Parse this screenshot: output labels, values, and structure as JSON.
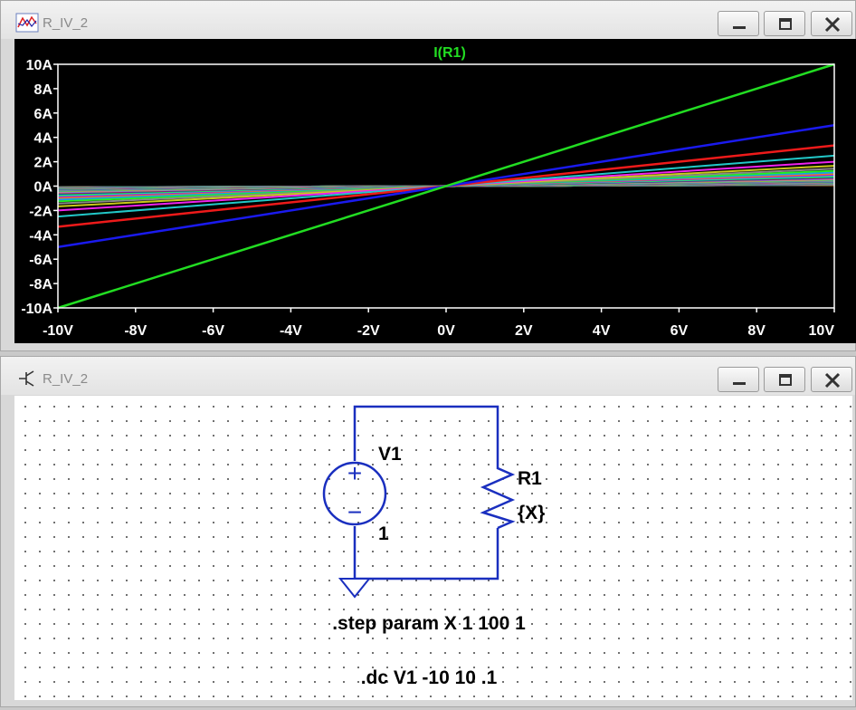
{
  "plot_window": {
    "title": "R_IV_2",
    "trace_label": "I(R1)",
    "buttons": {
      "minimize": "minimize",
      "maximize": "maximize",
      "close": "close"
    }
  },
  "schematic_window": {
    "title": "R_IV_2",
    "source_name": "V1",
    "source_value": "1",
    "source_plus": "+",
    "source_minus": "−",
    "resistor_name": "R1",
    "resistor_value": "{X}",
    "directive_step": ".step param X 1 100 1",
    "directive_dc": ".dc V1 -10 10 .1"
  },
  "colors": {
    "plot_bg": "#000000",
    "axis": "#ffffff",
    "trace_primary": "#22dd22",
    "wire": "#1a2fbf",
    "ground": "#1a2fbf"
  },
  "chart_data": {
    "type": "line",
    "title": "I(R1)",
    "xlabel": "",
    "ylabel": "",
    "xlim": [
      -10,
      10
    ],
    "ylim": [
      -10,
      10
    ],
    "x_ticks": [
      "-10V",
      "-8V",
      "-6V",
      "-4V",
      "-2V",
      "0V",
      "2V",
      "4V",
      "6V",
      "8V",
      "10V"
    ],
    "y_ticks": [
      "10A",
      "8A",
      "6A",
      "4A",
      "2A",
      "0A",
      "-2A",
      "-4A",
      "-6A",
      "-8A",
      "-10A"
    ],
    "x_tick_values": [
      -10,
      -8,
      -6,
      -4,
      -2,
      0,
      2,
      4,
      6,
      8,
      10
    ],
    "y_tick_values": [
      10,
      8,
      6,
      4,
      2,
      0,
      -2,
      -4,
      -6,
      -8,
      -10
    ],
    "grid": false,
    "series_rule": "I = V / X for X = 1 to 100 step 1",
    "x": [
      -10,
      10
    ],
    "resistances": [
      1,
      2,
      3,
      4,
      5,
      6,
      7,
      8,
      9,
      10,
      11,
      12,
      13,
      14,
      15,
      16,
      17,
      18,
      19,
      20,
      21,
      22,
      23,
      24,
      25,
      26,
      27,
      28,
      29,
      30,
      31,
      32,
      33,
      34,
      35,
      36,
      37,
      38,
      39,
      40,
      41,
      42,
      43,
      44,
      45,
      46,
      47,
      48,
      49,
      50,
      51,
      52,
      53,
      54,
      55,
      56,
      57,
      58,
      59,
      60,
      61,
      62,
      63,
      64,
      65,
      66,
      67,
      68,
      69,
      70,
      71,
      72,
      73,
      74,
      75,
      76,
      77,
      78,
      79,
      80,
      81,
      82,
      83,
      84,
      85,
      86,
      87,
      88,
      89,
      90,
      91,
      92,
      93,
      94,
      95,
      96,
      97,
      98,
      99,
      100
    ],
    "palette": [
      "#22dd22",
      "#1a1aee",
      "#ee1a1a",
      "#22c8c8",
      "#ee22ee",
      "#c8c81a",
      "#888888",
      "#22ee22",
      "#1a9aee",
      "#ee7a1a",
      "#9a1aee",
      "#1aee9a"
    ]
  }
}
